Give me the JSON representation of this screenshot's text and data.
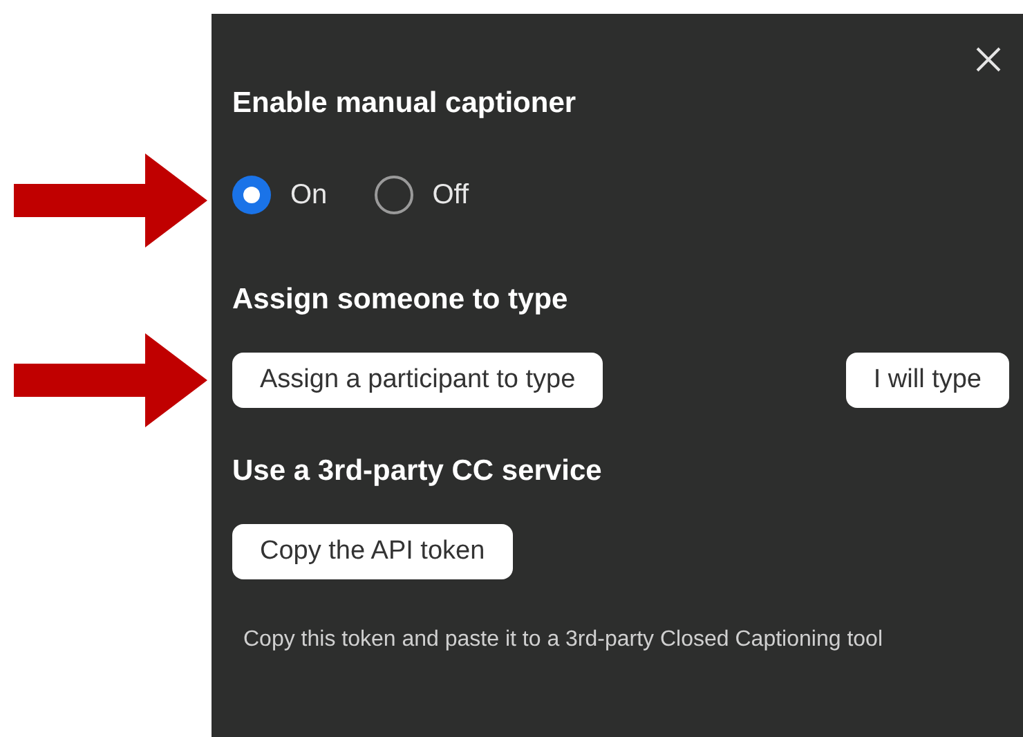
{
  "panel": {
    "title": "Enable manual captioner",
    "options": [
      {
        "label": "On",
        "selected": true
      },
      {
        "label": "Off",
        "selected": false
      }
    ],
    "assign_heading": "Assign someone to type",
    "assign_buttons": [
      "Assign a participant to type",
      "I will type"
    ],
    "service_heading": "Use a 3rd-party CC service",
    "service_button": "Copy the API token",
    "service_note": "Copy this token and paste it to a 3rd-party Closed Captioning tool"
  }
}
